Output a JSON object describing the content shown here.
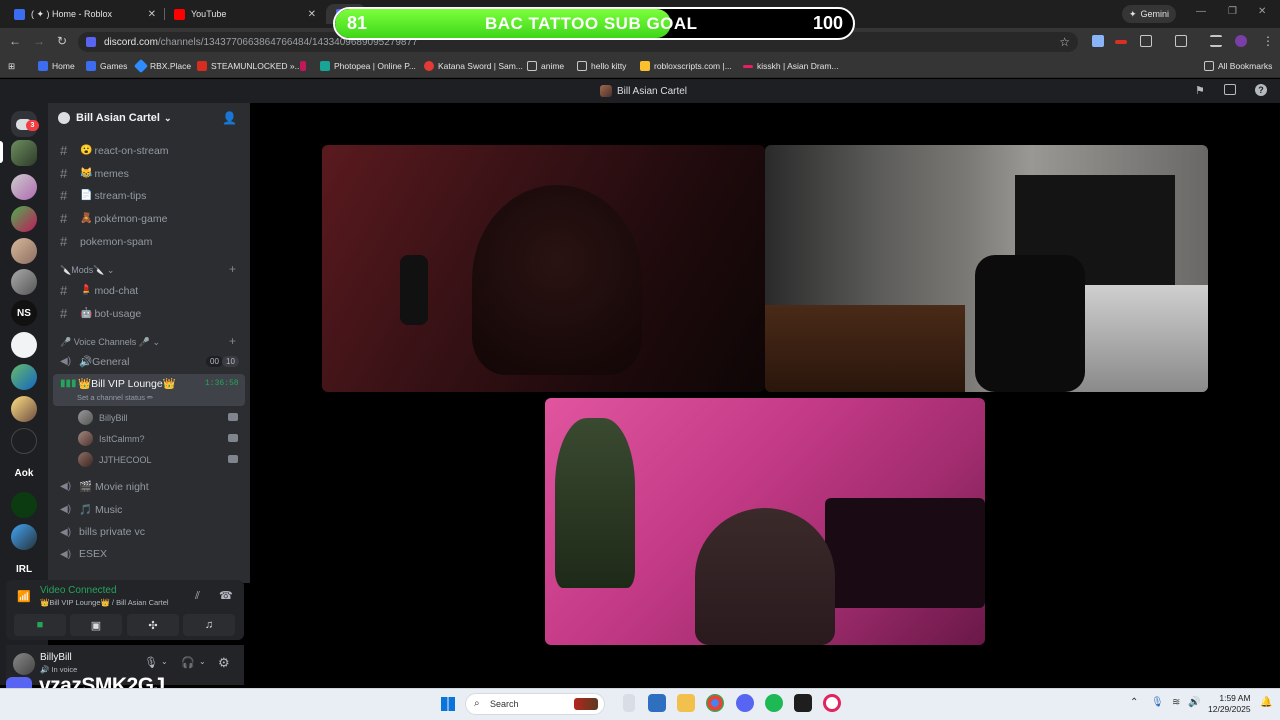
{
  "browser": {
    "tabs": [
      {
        "title": "( ✦ ) Home - Roblox",
        "fav_color": "#3a6df0"
      },
      {
        "title": "YouTube",
        "fav_color": "#ff0000"
      }
    ],
    "gemini_label": "Gemini",
    "url_host": "discord.com",
    "url_path": "/channels/1343770663864766484/1433409689095279877",
    "bookmarks": [
      {
        "label": "Home",
        "color": "#3a6df0"
      },
      {
        "label": "Games",
        "color": "#3a6df0"
      },
      {
        "label": "RBX.Place",
        "color": "#2d8cff"
      },
      {
        "label": "STEAMUNLOCKED »...",
        "color": "#d62d20"
      },
      {
        "label": "",
        "color": "#c2185b"
      },
      {
        "label": "Photopea | Online P...",
        "color": "#18a497"
      },
      {
        "label": "Katana Sword | Sam...",
        "color": "#e53935"
      },
      {
        "label": "anime",
        "color": "#9e9e9e"
      },
      {
        "label": "hello kitty",
        "color": "#9e9e9e"
      },
      {
        "label": "robloxscripts.com |...",
        "color": "#fbc02d"
      },
      {
        "label": "kisskh | Asian Dram...",
        "color": "#e91e63"
      }
    ],
    "all_bookmarks": "All Bookmarks"
  },
  "overlay_goal": {
    "current": "81",
    "title": "BAC TATTOO SUB GOAL",
    "target": "100",
    "progress": 0.81
  },
  "discord": {
    "window_title": "Bill Asian Cartel",
    "server_name": "Bill Asian Cartel",
    "guild_badge": "3",
    "guild_labels": {
      "ns": "NS",
      "aok": "Aok",
      "irl": "IRL"
    },
    "text_channels": [
      {
        "emoji": "😮",
        "name": "react-on-stream"
      },
      {
        "emoji": "😹",
        "name": "memes"
      },
      {
        "emoji": "📄",
        "name": "stream-tips"
      },
      {
        "emoji": "🧸",
        "name": "pokémon-game"
      },
      {
        "emoji": "",
        "name": "pokemon-spam"
      }
    ],
    "mods_category": "🔪Mods🔪",
    "mod_channels": [
      {
        "emoji": "💄",
        "name": "mod-chat"
      },
      {
        "emoji": "🤖",
        "name": "bot-usage"
      }
    ],
    "voice_category": "🎤 Voice Channels 🎤",
    "general": {
      "name": "🔊General",
      "count": "00",
      "limit": "10"
    },
    "vip": {
      "name": "👑Bill VIP Lounge👑",
      "timer": "1:36:58",
      "status_prompt": "Set a channel status ✏"
    },
    "vip_users": [
      "BillyBill",
      "IsItCalmm?",
      "JJTHECOOL"
    ],
    "voice_channels": [
      "🎬 Movie night",
      "🎵 Music",
      "bills private vc",
      "ESEX"
    ],
    "voice_panel": {
      "status": "Video Connected",
      "location": "👑Bill VIP Lounge👑 / Bill Asian Cartel"
    },
    "user": {
      "name": "BillyBill",
      "status": "🔊 In voice"
    }
  },
  "watermark": "vzazSMK2GJ",
  "taskbar": {
    "search_placeholder": "Search",
    "time": "1:59 AM",
    "date": "12/29/2025"
  }
}
